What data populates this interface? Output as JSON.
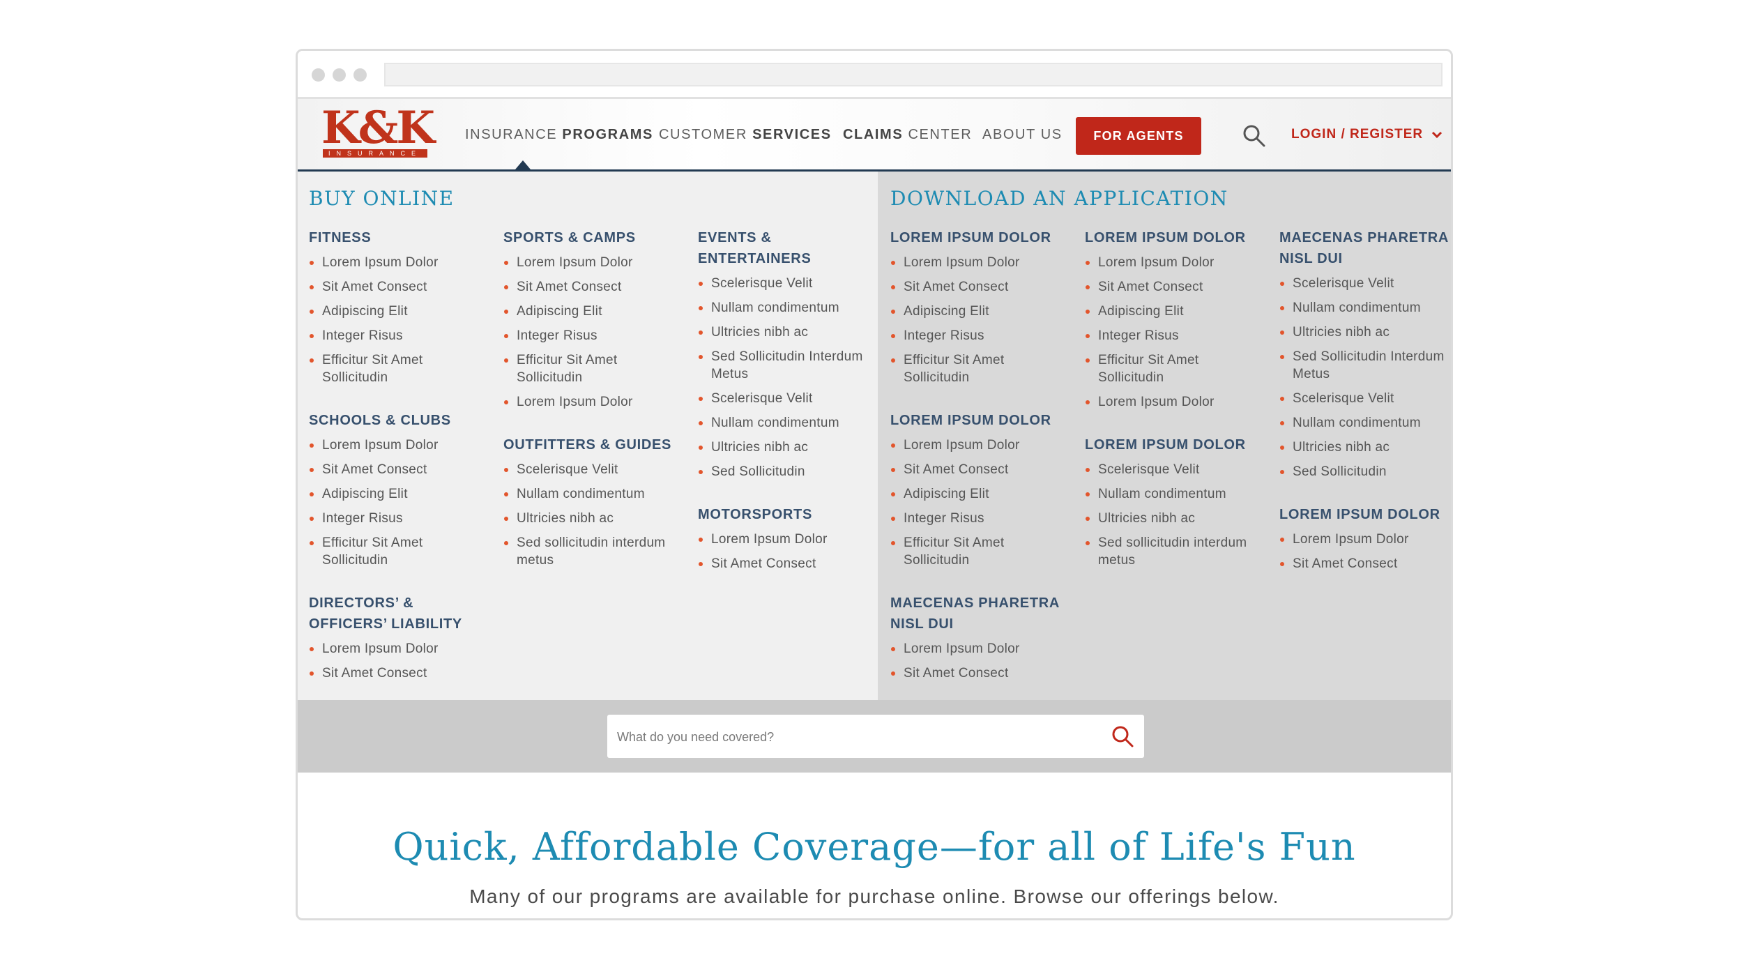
{
  "header": {
    "logo": "K&K",
    "logo_tagline": "INSURANCE",
    "nav": [
      {
        "light": "Insurance",
        "bold": "Programs"
      },
      {
        "light": "Customer",
        "bold": "Services"
      },
      {
        "bold": "Claims",
        "light": "Center"
      },
      {
        "light": "About Us"
      }
    ],
    "agents_button": "FOR AGENTS",
    "login": "LOGIN / REGISTER"
  },
  "buy_online": {
    "title": "BUY ONLINE",
    "columns": [
      [
        {
          "heading": "FITNESS",
          "items": [
            "Lorem Ipsum Dolor",
            "Sit Amet Consect",
            "Adipiscing Elit",
            "Integer Risus",
            "Efficitur Sit Amet Sollicitudin"
          ]
        },
        {
          "heading": "SCHOOLS & CLUBS",
          "items": [
            "Lorem Ipsum Dolor",
            "Sit Amet Consect",
            "Adipiscing Elit",
            "Integer Risus",
            "Efficitur Sit Amet Sollicitudin"
          ]
        },
        {
          "heading": "DIRECTORS’ & OFFICERS’ LIABILITY",
          "items": [
            "Lorem Ipsum Dolor",
            "Sit Amet Consect"
          ]
        }
      ],
      [
        {
          "heading": "SPORTS & CAMPS",
          "items": [
            "Lorem Ipsum Dolor",
            "Sit Amet Consect",
            "Adipiscing Elit",
            "Integer Risus",
            "Efficitur Sit Amet Sollicitudin",
            "Lorem Ipsum Dolor"
          ]
        },
        {
          "heading": "OUTFITTERS & GUIDES",
          "items": [
            "Scelerisque Velit",
            "Nullam condimentum",
            "Ultricies nibh ac",
            "Sed sollicitudin interdum metus"
          ]
        }
      ],
      [
        {
          "heading": "EVENTS & ENTERTAINERS",
          "items": [
            "Scelerisque Velit",
            "Nullam condimentum",
            "Ultricies nibh ac",
            "Sed Sollicitudin Interdum Metus",
            "Scelerisque Velit",
            "Nullam condimentum",
            "Ultricies nibh ac",
            "Sed Sollicitudin"
          ]
        },
        {
          "heading": "MOTORSPORTS",
          "items": [
            "Lorem Ipsum Dolor",
            "Sit Amet Consect"
          ]
        }
      ]
    ]
  },
  "download": {
    "title": "DOWNLOAD AN APPLICATION",
    "columns": [
      [
        {
          "heading": "LOREM IPSUM DOLOR",
          "items": [
            "Lorem Ipsum Dolor",
            "Sit Amet Consect",
            "Adipiscing Elit",
            "Integer Risus",
            "Efficitur Sit Amet Sollicitudin"
          ]
        },
        {
          "heading": "LOREM IPSUM DOLOR",
          "items": [
            "Lorem Ipsum Dolor",
            "Sit Amet Consect",
            "Adipiscing Elit",
            "Integer Risus",
            "Efficitur Sit Amet Sollicitudin"
          ]
        },
        {
          "heading": "MAECENAS PHARETRA NISL DUI",
          "items": [
            "Lorem Ipsum Dolor",
            "Sit Amet Consect"
          ]
        }
      ],
      [
        {
          "heading": "LOREM IPSUM DOLOR",
          "items": [
            "Lorem Ipsum Dolor",
            "Sit Amet Consect",
            "Adipiscing Elit",
            "Integer Risus",
            "Efficitur Sit Amet Sollicitudin",
            "Lorem Ipsum Dolor"
          ]
        },
        {
          "heading": "LOREM IPSUM DOLOR",
          "items": [
            "Scelerisque Velit",
            "Nullam condimentum",
            "Ultricies nibh ac",
            "Sed sollicitudin interdum metus"
          ]
        }
      ],
      [
        {
          "heading": "MAECENAS PHARETRA NISL DUI",
          "items": [
            "Scelerisque Velit",
            "Nullam condimentum",
            "Ultricies nibh ac",
            "Sed Sollicitudin Interdum Metus",
            "Scelerisque Velit",
            "Nullam condimentum",
            "Ultricies nibh ac",
            "Sed Sollicitudin"
          ]
        },
        {
          "heading": "LOREM IPSUM DOLOR",
          "items": [
            "Lorem Ipsum Dolor",
            "Sit Amet Consect"
          ]
        }
      ]
    ]
  },
  "search": {
    "placeholder": "What do you need covered?"
  },
  "hero": {
    "title": "Quick, Affordable Coverage—for all of Life's Fun",
    "subtitle": "Many of our programs are available for purchase online. Browse our offerings below."
  },
  "colors": {
    "accent_red": "#c0271a",
    "heading_blue": "#1d8bb2",
    "nav_navy": "#223a52",
    "bullet_orange": "#e2552c"
  }
}
